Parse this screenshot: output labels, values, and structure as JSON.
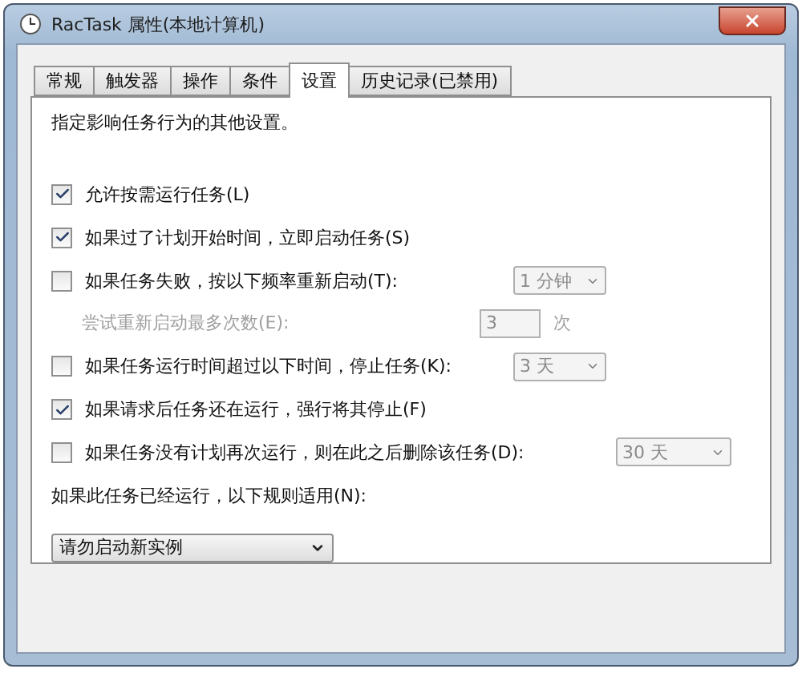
{
  "window": {
    "title": "RacTask 属性(本地计算机)"
  },
  "tabs": [
    {
      "label": "常规",
      "selected": false
    },
    {
      "label": "触发器",
      "selected": false
    },
    {
      "label": "操作",
      "selected": false
    },
    {
      "label": "条件",
      "selected": false
    },
    {
      "label": "设置",
      "selected": true
    },
    {
      "label": "历史记录(已禁用)",
      "selected": false
    }
  ],
  "description": "指定影响任务行为的其他设置。",
  "options": [
    {
      "kind": "checkbox",
      "label": "允许按需运行任务(L)",
      "checked": true
    },
    {
      "kind": "checkbox",
      "label": "如果过了计划开始时间，立即启动任务(S)",
      "checked": true
    },
    {
      "kind": "checkbox",
      "label": "如果任务失败，按以下频率重新启动(T):",
      "checked": false,
      "dropdown": {
        "value": "1 分钟",
        "disabled": true
      }
    },
    {
      "kind": "number",
      "label": "尝试重新启动最多次数(E):",
      "disabled": true,
      "value": "3",
      "unit": "次"
    },
    {
      "kind": "checkbox",
      "label": "如果任务运行时间超过以下时间，停止任务(K):",
      "checked": false,
      "dropdown": {
        "value": "3 天",
        "disabled": true
      }
    },
    {
      "kind": "checkbox",
      "label": "如果请求后任务还在运行，强行将其停止(F)",
      "checked": true
    },
    {
      "kind": "checkbox",
      "label": "如果任务没有计划再次运行，则在此之后删除该任务(D):",
      "checked": false,
      "dropdown": {
        "value": "30 天",
        "disabled": true
      }
    }
  ],
  "rule": {
    "label": "如果此任务已经运行，以下规则适用(N):",
    "value": "请勿启动新实例"
  }
}
